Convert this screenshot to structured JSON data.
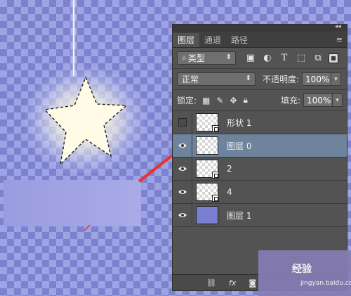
{
  "panel": {
    "tabs": [
      {
        "label": "图层",
        "active": true
      },
      {
        "label": "通道",
        "active": false
      },
      {
        "label": "路径",
        "active": false
      }
    ],
    "top_glyph": "◂◂",
    "close_glyph": "×",
    "menu_glyph": "≡",
    "filter": {
      "label": "类型",
      "icon": "search-icon"
    },
    "blend_mode": "正常",
    "opacity_label": "不透明度:",
    "opacity_value": "100%",
    "lock_label": "锁定:",
    "fill_label": "填充:",
    "fill_value": "100%",
    "layers": [
      {
        "name": "形状 1",
        "visible": false,
        "thumb": "checker-smart"
      },
      {
        "name": "图层 0",
        "visible": true,
        "thumb": "checker",
        "selected": true
      },
      {
        "name": "2",
        "visible": true,
        "thumb": "checker-smart"
      },
      {
        "name": "4",
        "visible": true,
        "thumb": "checker-smart"
      },
      {
        "name": "图层 1",
        "visible": true,
        "thumb": "solid"
      }
    ],
    "bottom_icons": [
      "link-icon",
      "fx-icon",
      "mask-icon"
    ]
  },
  "watermark": {
    "text": "经验",
    "url": "jingyan.baidu.com"
  },
  "colors": {
    "selected_row": "#6e849d",
    "arrow": "#e8342d"
  }
}
